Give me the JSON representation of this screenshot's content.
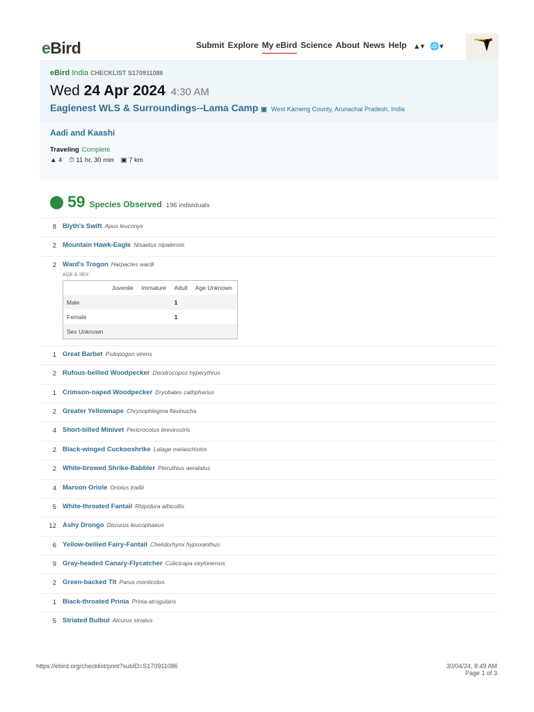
{
  "header": {
    "logo_e": "e",
    "logo_rest": "Bird",
    "nav": [
      "Submit",
      "Explore",
      "My eBird",
      "Science",
      "About",
      "News",
      "Help"
    ],
    "active": "My eBird"
  },
  "checklist": {
    "portal_e": "eBird",
    "portal_region": "India",
    "id_label": "CHECKLIST S170911086",
    "weekday": "Wed",
    "date": "24 Apr 2024",
    "time": "4:30 AM",
    "location": "Eaglenest WLS & Surroundings--Lama Camp",
    "region": "West Kameng County,  Arunachal Pradesh,  India",
    "observers": "Aadi and Kaashi",
    "protocol": "Traveling",
    "status": "Complete",
    "party": "4",
    "duration": "11 hr, 30 min",
    "distance": "7 km"
  },
  "summary": {
    "count": "59",
    "label": "Species Observed",
    "individuals": "196 individuals"
  },
  "age_sex": {
    "label": "AGE & SEX:",
    "cols": [
      "",
      "Juvenile",
      "Immature",
      "Adult",
      "Age Unknown"
    ],
    "rows": [
      [
        "Male",
        "",
        "",
        "1",
        ""
      ],
      [
        "Female",
        "",
        "",
        "1",
        ""
      ],
      [
        "Sex Unknown",
        "",
        "",
        "",
        ""
      ]
    ]
  },
  "species": [
    {
      "q": "8",
      "cn": "Blyth's Swift",
      "sn": "Apus leuconyx"
    },
    {
      "q": "2",
      "cn": "Mountain Hawk-Eagle",
      "sn": "Nisaetus nipalensis"
    },
    {
      "q": "2",
      "cn": "Ward's Trogon",
      "sn": "Harpactes wardi"
    },
    {
      "q": "1",
      "cn": "Great Barbet",
      "sn": "Psilopogon virens"
    },
    {
      "q": "2",
      "cn": "Rufous-bellied Woodpecker",
      "sn": "Dendrocopos hyperythrus"
    },
    {
      "q": "1",
      "cn": "Crimson-naped Woodpecker",
      "sn": "Dryobates cathpharius"
    },
    {
      "q": "2",
      "cn": "Greater Yellownape",
      "sn": "Chrysophlegma flavinucha"
    },
    {
      "q": "4",
      "cn": "Short-billed Minivet",
      "sn": "Pericrocotus brevirostris"
    },
    {
      "q": "2",
      "cn": "Black-winged Cuckooshrike",
      "sn": "Lalage melaschistos"
    },
    {
      "q": "2",
      "cn": "White-browed Shrike-Babbler",
      "sn": "Pteruthius aeralatus"
    },
    {
      "q": "4",
      "cn": "Maroon Oriole",
      "sn": "Oriolus traillii"
    },
    {
      "q": "5",
      "cn": "White-throated Fantail",
      "sn": "Rhipidura albicollis"
    },
    {
      "q": "12",
      "cn": "Ashy Drongo",
      "sn": "Dicrurus leucophaeus"
    },
    {
      "q": "6",
      "cn": "Yellow-bellied Fairy-Fantail",
      "sn": "Chelidorhynx hypoxanthus"
    },
    {
      "q": "9",
      "cn": "Gray-headed Canary-Flycatcher",
      "sn": "Culicicapa ceylonensis"
    },
    {
      "q": "2",
      "cn": "Green-backed Tit",
      "sn": "Parus monticolus"
    },
    {
      "q": "1",
      "cn": "Black-throated Prinia",
      "sn": "Prinia atrogularis"
    },
    {
      "q": "5",
      "cn": "Striated Bulbul",
      "sn": "Alcurus striatus"
    }
  ],
  "footer": {
    "url": "https://ebird.org/checklist/print?subID=S170911086",
    "printed": "30/04/24, 8:49 AM",
    "page": "Page 1 of 3"
  }
}
